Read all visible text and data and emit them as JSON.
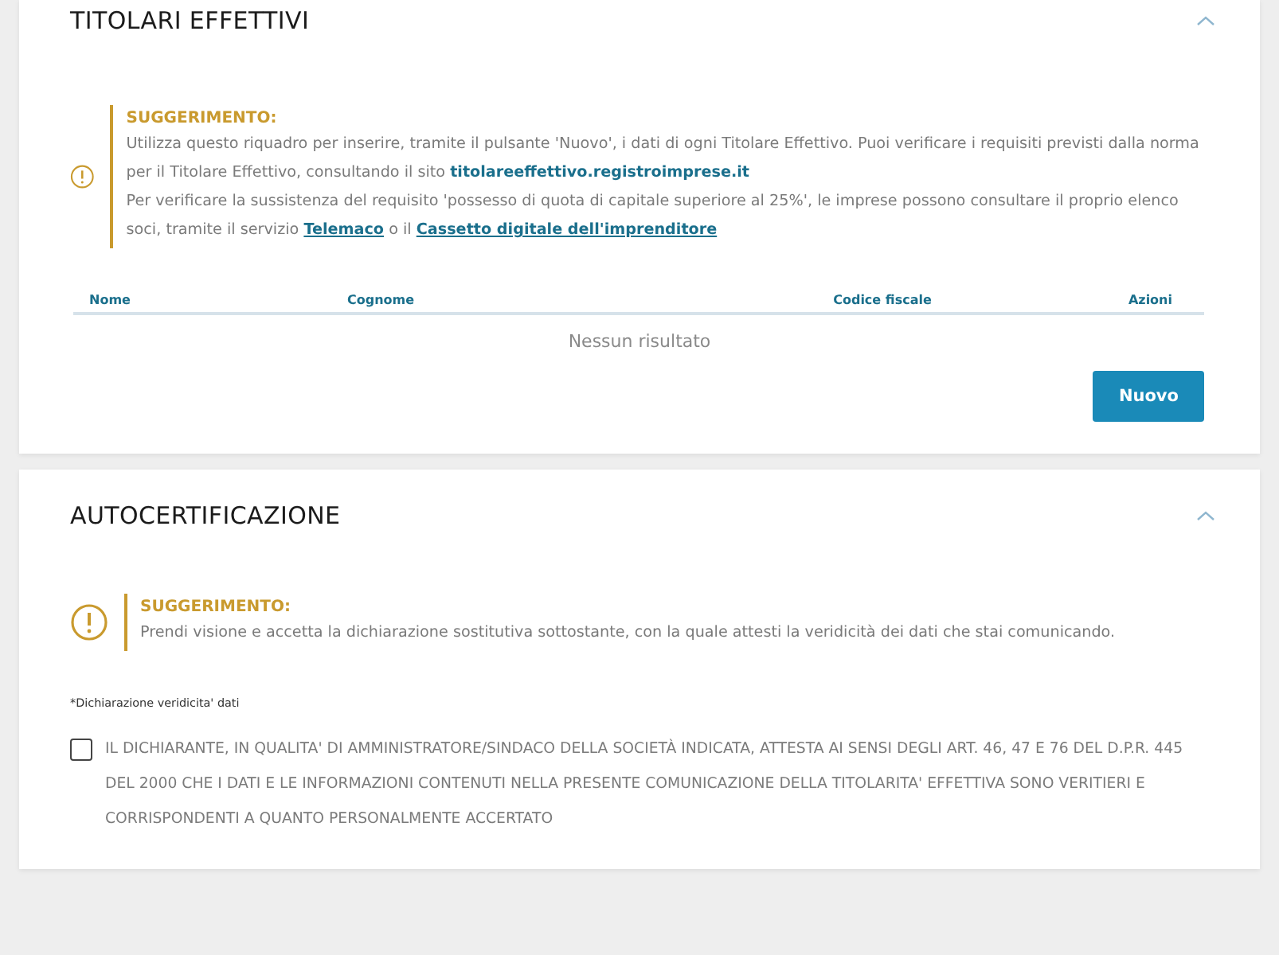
{
  "sections": [
    {
      "title": "TITOLARI EFFETTIVI",
      "expanded": true,
      "hint": {
        "label": "SUGGERIMENTO:",
        "paragraphs": [
          [
            {
              "kind": "text",
              "text": "Utilizza questo riquadro per inserire, tramite il pulsante 'Nuovo', i dati di ogni Titolare Effettivo. Puoi verificare i requisiti previsti dalla norma per il Titolare Effettivo, consultando il sito "
            },
            {
              "kind": "link",
              "text": "titolareeffettivo.registroimprese.it"
            }
          ],
          [
            {
              "kind": "text",
              "text": "Per verificare la sussistenza del requisito 'possesso di quota di capitale superiore al 25%', le imprese possono consultare il proprio elenco soci, tramite il servizio "
            },
            {
              "kind": "underlined-link",
              "text": "Telemaco"
            },
            {
              "kind": "text",
              "text": " o il "
            },
            {
              "kind": "underlined-link",
              "text": "Cassetto digitale dell'imprenditore"
            }
          ]
        ]
      },
      "table": {
        "columns": [
          "Nome",
          "Cognome",
          "Codice fiscale",
          "Azioni"
        ],
        "empty_text": "Nessun risultato"
      },
      "button": "Nuovo"
    },
    {
      "title": "AUTOCERTIFICAZIONE",
      "expanded": true,
      "hint": {
        "label": "SUGGERIMENTO:",
        "paragraphs": [
          [
            {
              "kind": "text",
              "text": "Prendi visione e accetta la dichiarazione sostitutiva sottostante, con la quale attesti la veridicità dei dati che stai comunicando."
            }
          ]
        ]
      },
      "field_label": "*Dichiarazione veridicita' dati",
      "checkbox": {
        "checked": false,
        "label": "IL DICHIARANTE, IN QUALITA' DI AMMINISTRATORE/SINDACO DELLA SOCIETÀ INDICATA, ATTESTA AI SENSI DEGLI ART. 46, 47 E 76 DEL D.P.R. 445 DEL 2000 CHE I DATI E LE INFORMAZIONI CONTENUTI NELLA PRESENTE COMUNICAZIONE DELLA TITOLARITA' EFFETTIVA SONO VERITIERI E CORRISPONDENTI A QUANTO PERSONALMENTE ACCERTATO"
      }
    }
  ]
}
